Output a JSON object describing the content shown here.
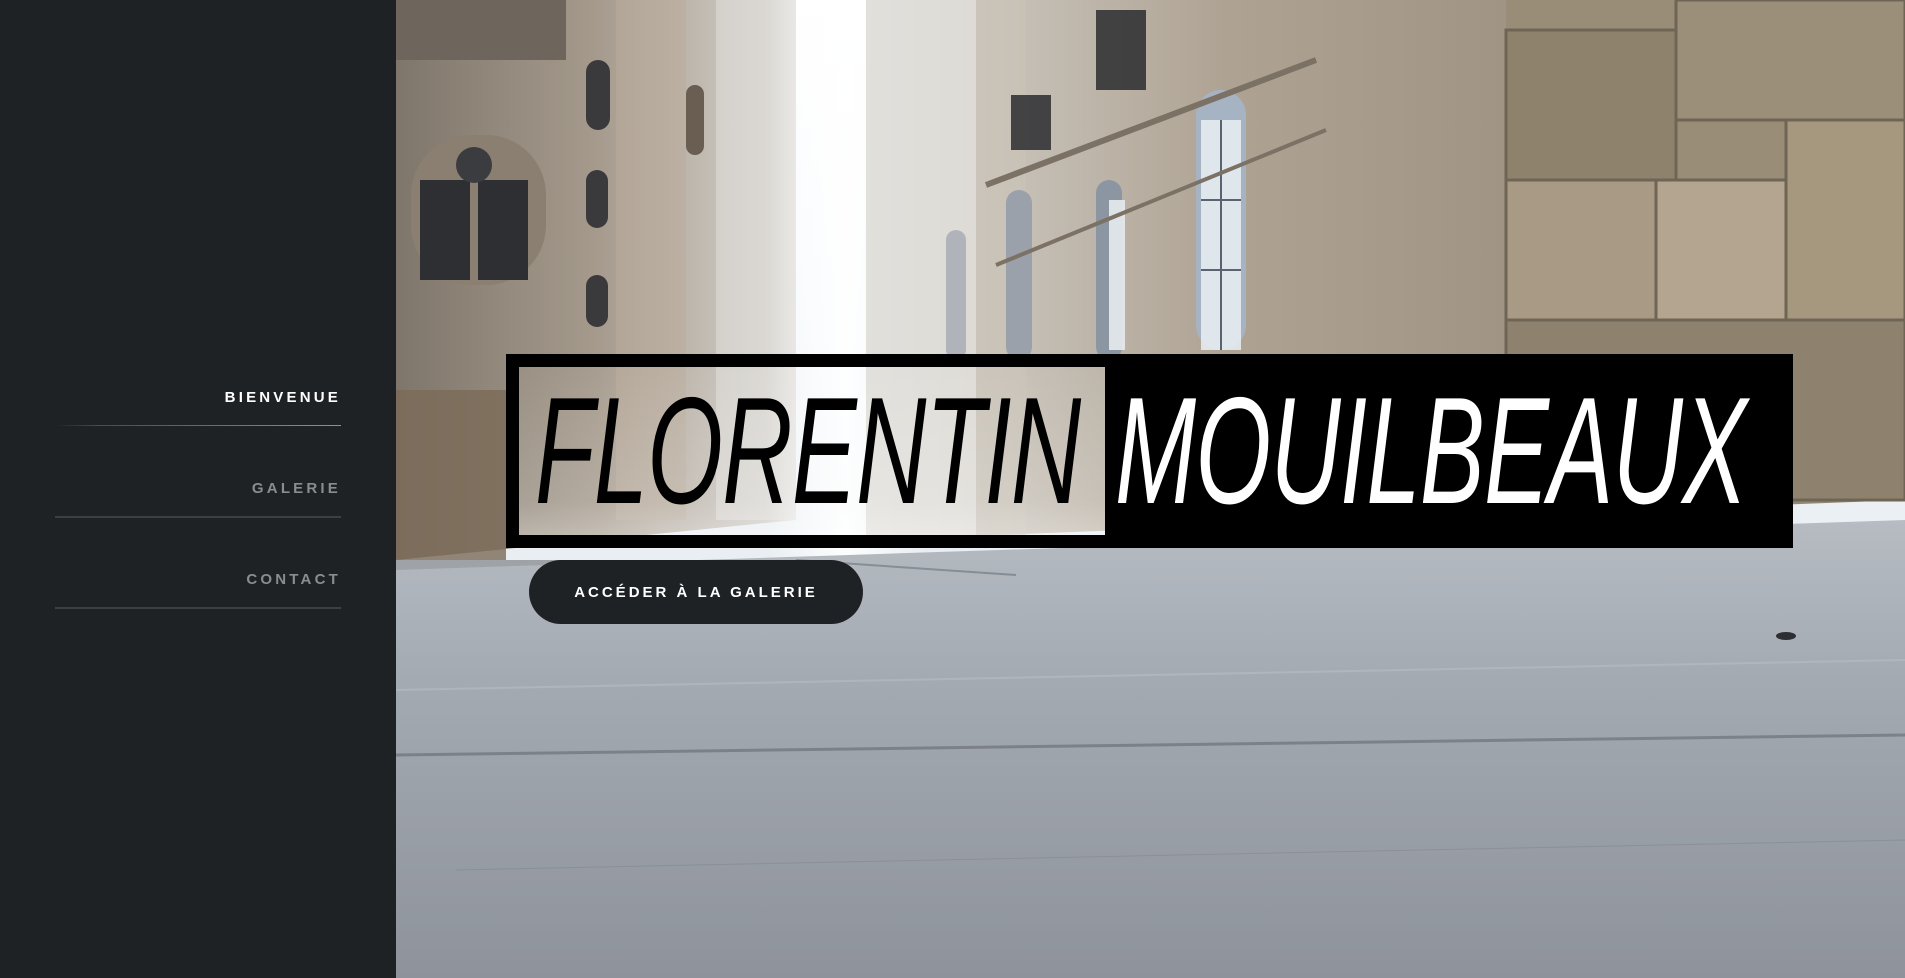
{
  "sidebar": {
    "items": [
      {
        "label": "BIENVENUE",
        "active": true
      },
      {
        "label": "GALERIE",
        "active": false
      },
      {
        "label": "CONTACT",
        "active": false
      }
    ]
  },
  "hero": {
    "first_name": "FLORENTIN",
    "last_name": "MOUILBEAUX",
    "cta_label": "ACCÉDER À LA GALERIE"
  },
  "colors": {
    "sidebar_bg": "#1f2225",
    "button_bg": "#1f2225",
    "title_block": "#000000",
    "active_text": "#ffffff",
    "inactive_text": "#8a8c8e"
  },
  "icons": [
    "background-photo"
  ]
}
